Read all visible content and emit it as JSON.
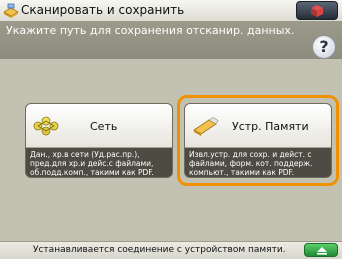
{
  "header": {
    "title": "Сканировать и сохранить",
    "title_icon": "scan-save-icon",
    "right_button_icon": "counter-check-icon"
  },
  "instruction": {
    "text": "Укажите путь для сохранения отсканир. данных.",
    "help_label": "?"
  },
  "options": [
    {
      "label": "Сеть",
      "icon": "network-icon",
      "description": "Дан., хр.в сети (Уд.рас.пр.),\nпред.для хр.и дейс.с файлами,\nоб.подд.комп., такими как PDF.",
      "selected": false
    },
    {
      "label": "Устр. Памяти",
      "icon": "memory-stick-icon",
      "description": "Извл.устр. для сохр. и дейст. с\nфайлами, форм. кот. поддерж.\nкомпьют., такими как PDF.",
      "selected": true
    }
  ],
  "status": {
    "text": "Устанавливается соединение с устройством памяти.",
    "button_icon": "status-monitor-icon"
  },
  "colors": {
    "background": "#c3c2b2",
    "instruction_bar": "#9c9a8b",
    "selection_highlight": "#f09100",
    "panel_description_bg": "#4d4b42",
    "status_button": "#2fa544"
  }
}
